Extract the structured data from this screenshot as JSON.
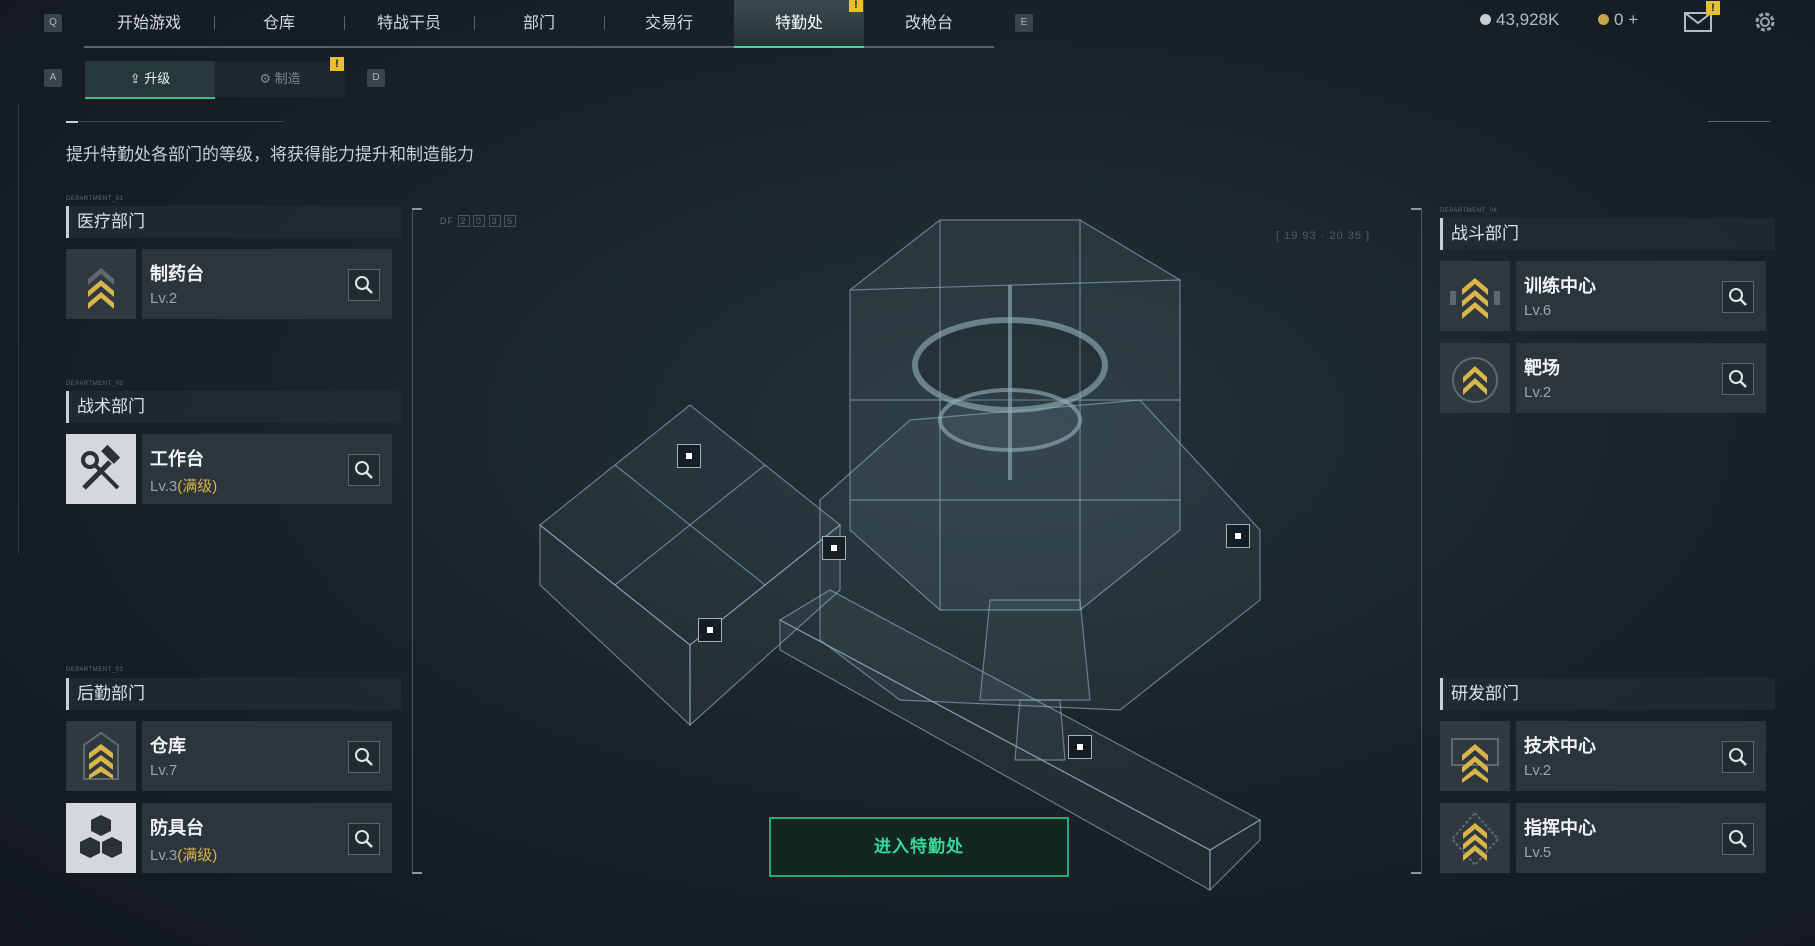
{
  "topnav": {
    "left_key": "Q",
    "right_key": "E",
    "tabs": [
      "开始游戏",
      "仓库",
      "特战干员",
      "部门",
      "交易行",
      "特勤处",
      "改枪台"
    ],
    "active_tab": "特勤处",
    "warning_mark": "!"
  },
  "currency": {
    "silver": "43,928K",
    "gold": "0",
    "gold_plus": "+"
  },
  "subtabs": {
    "left_key": "A",
    "right_key": "D",
    "upgrade": "升级",
    "craft": "制造"
  },
  "description": "提升特勤处各部门的等级，将获得能力提升和制造能力",
  "departments": {
    "medical": {
      "micro": "DEPARTMENT_01",
      "title": "医疗部门",
      "items": [
        {
          "name": "制药台",
          "level": "Lv.2",
          "maxed": ""
        }
      ]
    },
    "tactical": {
      "micro": "DEPARTMENT_02",
      "title": "战术部门",
      "items": [
        {
          "name": "工作台",
          "level": "Lv.3",
          "maxed": "(满级)"
        }
      ]
    },
    "logistics": {
      "micro": "DEPARTMENT_03",
      "title": "后勤部门",
      "items": [
        {
          "name": "仓库",
          "level": "Lv.7",
          "maxed": ""
        },
        {
          "name": "防具台",
          "level": "Lv.3",
          "maxed": "(满级)"
        }
      ]
    },
    "combat": {
      "micro": "DEPARTMENT_04",
      "title": "战斗部门",
      "items": [
        {
          "name": "训练中心",
          "level": "Lv.6",
          "maxed": ""
        },
        {
          "name": "靶场",
          "level": "Lv.2",
          "maxed": ""
        }
      ]
    },
    "research": {
      "title": "研发部门",
      "items": [
        {
          "name": "技术中心",
          "level": "Lv.2",
          "maxed": ""
        },
        {
          "name": "指挥中心",
          "level": "Lv.5",
          "maxed": ""
        }
      ]
    }
  },
  "center": {
    "enter_button": "进入特勤处",
    "hud_label": "DF",
    "hud_digits": [
      "2",
      "0",
      "3",
      "5"
    ],
    "hud_coords": "[ 19 93 · 20 35 ]"
  },
  "colors": {
    "accent_green": "#35d99a",
    "warning_yellow": "#e8c02e",
    "maxed_gold": "#d6b54a",
    "rank_gold": "#d9b64a"
  },
  "icons": {
    "search": "search-icon",
    "settings": "gear-icon",
    "mail": "mail-icon",
    "rank": "rank-chevron-icon",
    "tools": "hammer-wrench-icon",
    "armor": "cubes-icon"
  }
}
